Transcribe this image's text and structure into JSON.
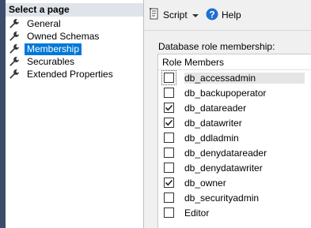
{
  "left_panel": {
    "header": "Select a page",
    "pages": [
      {
        "label": "General",
        "selected": false
      },
      {
        "label": "Owned Schemas",
        "selected": false
      },
      {
        "label": "Membership",
        "selected": true
      },
      {
        "label": "Securables",
        "selected": false
      },
      {
        "label": "Extended Properties",
        "selected": false
      }
    ]
  },
  "toolbar": {
    "script_label": "Script",
    "help_label": "Help"
  },
  "membership": {
    "grid_label": "Database role membership:",
    "columns": [
      "Role Members"
    ],
    "roles": [
      {
        "name": "db_accessadmin",
        "checked": false,
        "focused": true
      },
      {
        "name": "db_backupoperator",
        "checked": false,
        "focused": false
      },
      {
        "name": "db_datareader",
        "checked": true,
        "focused": false
      },
      {
        "name": "db_datawriter",
        "checked": true,
        "focused": false
      },
      {
        "name": "db_ddladmin",
        "checked": false,
        "focused": false
      },
      {
        "name": "db_denydatareader",
        "checked": false,
        "focused": false
      },
      {
        "name": "db_denydatawriter",
        "checked": false,
        "focused": false
      },
      {
        "name": "db_owner",
        "checked": true,
        "focused": false
      },
      {
        "name": "db_securityadmin",
        "checked": false,
        "focused": false
      },
      {
        "name": "Editor",
        "checked": false,
        "focused": false
      }
    ]
  },
  "colors": {
    "selected_bg": "#0078d7",
    "left_strip": "#3c4d6c",
    "header_bg": "#dfe4ea",
    "help_icon": "#1f6fcf"
  },
  "icons": {
    "page_item": "wrench-icon",
    "script": "script-icon",
    "script_dropdown": "caret-down-icon",
    "help": "help-icon"
  }
}
